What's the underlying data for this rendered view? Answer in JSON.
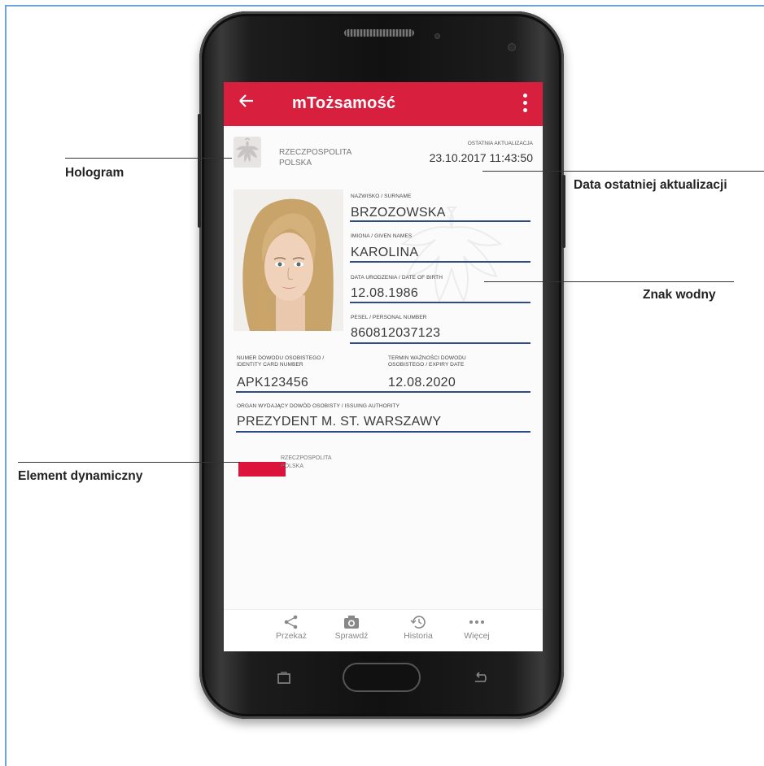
{
  "app": {
    "title": "mTożsamość"
  },
  "header": {
    "country_line1": "RZECZPOSPOLITA",
    "country_line2": "POLSKA",
    "update_label": "OSTATNIA AKTUALIZACJA",
    "update_value": "23.10.2017 11:43:50"
  },
  "fields": {
    "surname_label": "NAZWISKO / SURNAME",
    "surname_value": "BRZOZOWSKA",
    "given_label": "IMIONA / GIVEN NAMES",
    "given_value": "KAROLINA",
    "dob_label": "DATA URODZENIA / DATE OF BIRTH",
    "dob_value": "12.08.1986",
    "pesel_label": "PESEL / PERSONAL NUMBER",
    "pesel_value": "860812037123",
    "idnum_label1": "NUMER DOWODU OSOBISTEGO /",
    "idnum_label2": "IDENTITY CARD NUMBER",
    "idnum_value": "APK123456",
    "expiry_label1": "TERMIN WAŻNOŚCI DOWODU",
    "expiry_label2": "OSOBISTEGO / EXPIRY DATE",
    "expiry_value": "12.08.2020",
    "authority_label": "ORGAN WYDAJĄCY DOWÓD OSOBISTY / ISSUING AUTHORITY",
    "authority_value": "PREZYDENT M. ST. WARSZAWY"
  },
  "footer_badge": {
    "line1": "RZECZPOSPOLITA",
    "line2": "POLSKA",
    "flag_color": "#dc143c"
  },
  "nav": [
    {
      "label": "Przekaż",
      "icon": "share-icon"
    },
    {
      "label": "Sprawdź",
      "icon": "camera-icon"
    },
    {
      "label": "Historia",
      "icon": "history-icon"
    },
    {
      "label": "Więcej",
      "icon": "more-icon"
    }
  ],
  "annotations": {
    "hologram": "Hologram",
    "update": "Data ostatniej aktualizacji",
    "watermark": "Znak wodny",
    "dynamic": "Element dynamiczny"
  },
  "colors": {
    "accent": "#d91f3e",
    "underline": "#2f4a86"
  }
}
